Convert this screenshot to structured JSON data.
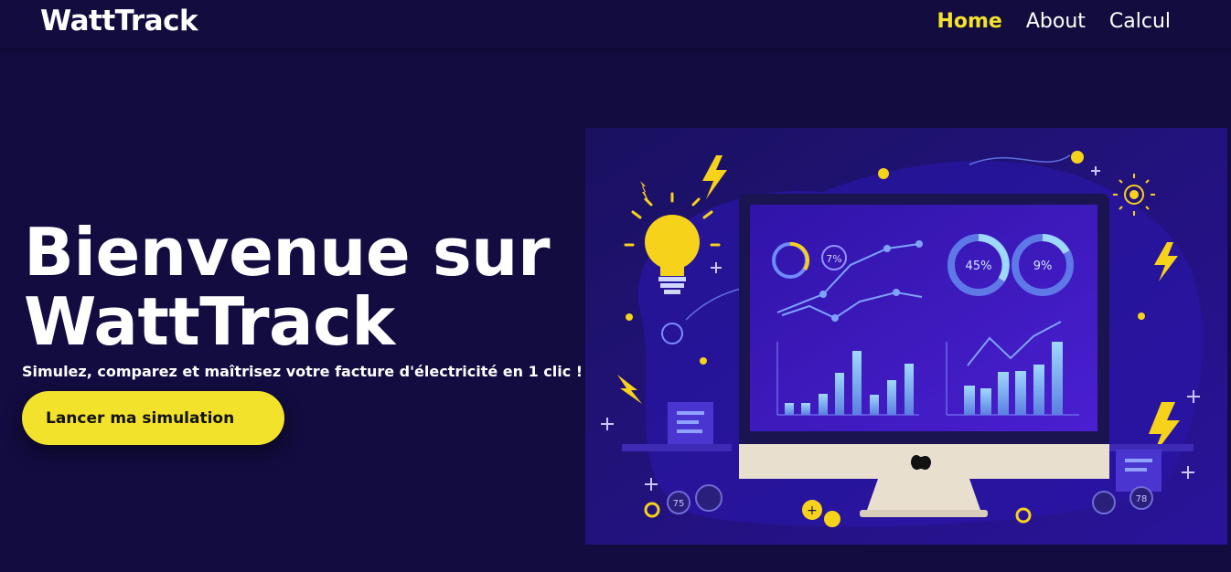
{
  "header": {
    "brand": "WattTrack",
    "nav": [
      {
        "label": "Home",
        "active": true
      },
      {
        "label": "About",
        "active": false
      },
      {
        "label": "Calcul",
        "active": false
      }
    ]
  },
  "hero": {
    "title_line1": "Bienvenue sur",
    "title_line2": "WattTrack",
    "subtitle": "Simulez, comparez et maîtrisez votre facture d'électricité en 1 clic !",
    "cta_label": "Lancer ma simulation"
  },
  "illustration": {
    "gauge_left": "7%",
    "gauge_mid": "45%",
    "gauge_right": "9%",
    "clock_left": "75",
    "clock_right": "78"
  },
  "colors": {
    "background": "#120c40",
    "accent": "#f3e22c",
    "screen": "#3b1bb5"
  }
}
